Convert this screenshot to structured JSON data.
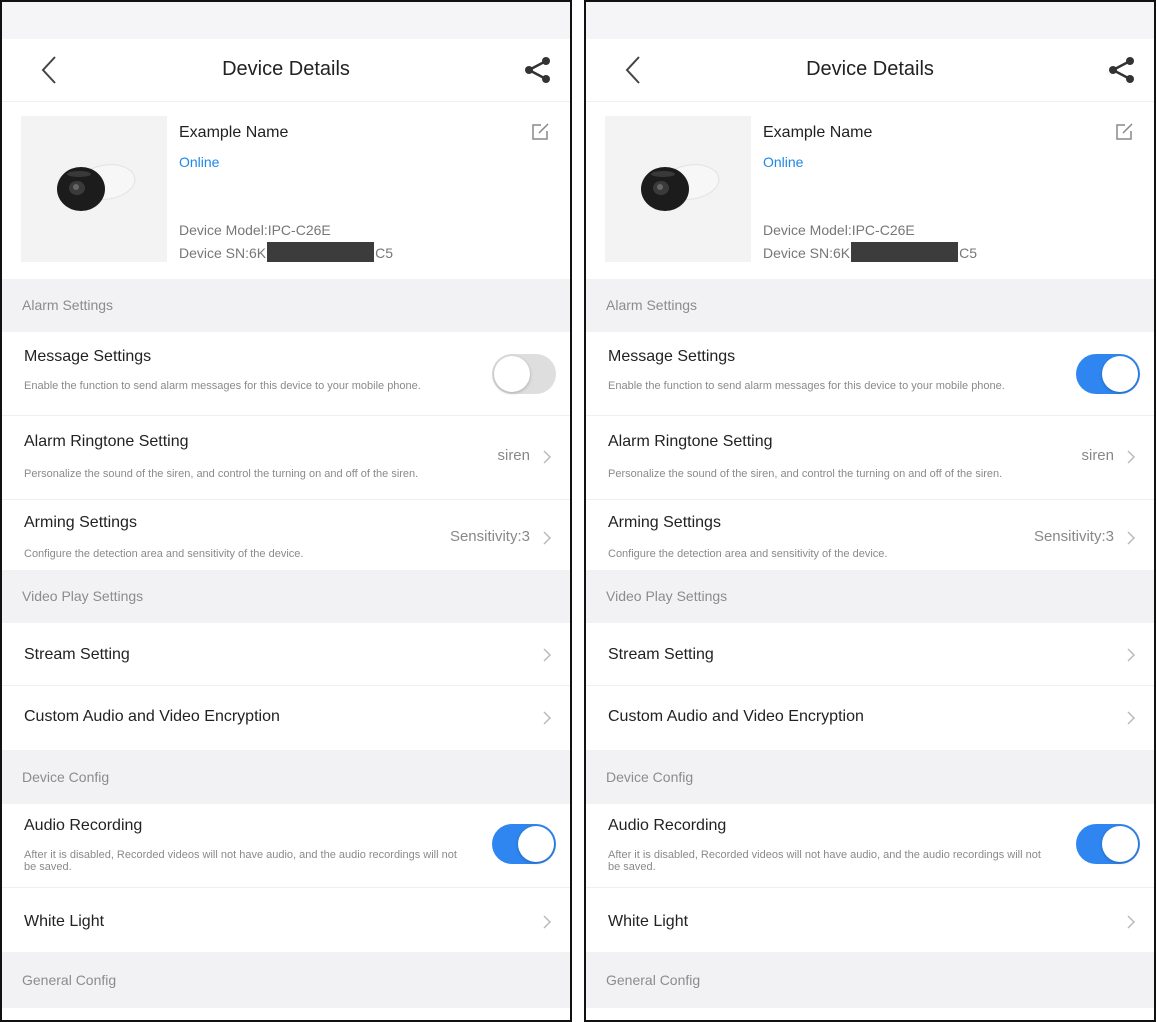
{
  "screens": [
    {
      "nav": {
        "title": "Device Details"
      },
      "device": {
        "name": "Example Name",
        "status": "Online",
        "model": "Device Model:IPC-C26E",
        "sn_prefix": "Device SN:6K",
        "sn_suffix": "C5"
      },
      "sections": {
        "alarm": "Alarm Settings",
        "video": "Video Play Settings",
        "device": "Device Config",
        "general": "General Config"
      },
      "rows": {
        "message": {
          "title": "Message Settings",
          "desc": "Enable the function to send alarm messages for this device to your mobile phone.",
          "enabled": false
        },
        "ringtone": {
          "title": "Alarm Ringtone Setting",
          "desc": "Personalize the sound of the siren, and control the turning on and off of the siren.",
          "value": "siren"
        },
        "arming": {
          "title": "Arming Settings",
          "desc": "Configure the detection area and sensitivity of the device.",
          "value": "Sensitivity:3"
        },
        "stream": {
          "title": "Stream Setting"
        },
        "encryption": {
          "title": "Custom Audio and Video Encryption"
        },
        "audio": {
          "title": "Audio Recording",
          "desc": "After it is disabled, Recorded videos will not have audio, and the audio recordings will not be saved.",
          "enabled": true
        },
        "white_light": {
          "title": "White Light"
        }
      }
    },
    {
      "nav": {
        "title": "Device Details"
      },
      "device": {
        "name": "Example Name",
        "status": "Online",
        "model": "Device Model:IPC-C26E",
        "sn_prefix": "Device SN:6K",
        "sn_suffix": "C5"
      },
      "sections": {
        "alarm": "Alarm Settings",
        "video": "Video Play Settings",
        "device": "Device Config",
        "general": "General Config"
      },
      "rows": {
        "message": {
          "title": "Message Settings",
          "desc": "Enable the function to send alarm messages for this device to your mobile phone.",
          "enabled": true
        },
        "ringtone": {
          "title": "Alarm Ringtone Setting",
          "desc": "Personalize the sound of the siren, and control the turning on and off of the siren.",
          "value": "siren"
        },
        "arming": {
          "title": "Arming Settings",
          "desc": "Configure the detection area and sensitivity of the device.",
          "value": "Sensitivity:3"
        },
        "stream": {
          "title": "Stream Setting"
        },
        "encryption": {
          "title": "Custom Audio and Video Encryption"
        },
        "audio": {
          "title": "Audio Recording",
          "desc": "After it is disabled, Recorded videos will not have audio, and the audio recordings will not be saved.",
          "enabled": true
        },
        "white_light": {
          "title": "White Light"
        }
      }
    }
  ],
  "colors": {
    "accent": "#1e88e5",
    "toggle_on": "#2f86f0",
    "toggle_off": "#dedede"
  },
  "icons": {
    "back": "chevron-left-icon",
    "share": "share-icon",
    "edit": "edit-icon",
    "row": "chevron-right-icon"
  }
}
